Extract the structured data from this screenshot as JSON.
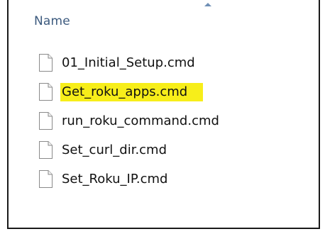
{
  "explorer": {
    "column_header": "Name",
    "sort_direction": "ascending",
    "highlight_color": "#f7ee1a",
    "files": [
      {
        "name": "01_Initial_Setup.cmd",
        "highlighted": false
      },
      {
        "name": "Get_roku_apps.cmd",
        "highlighted": true
      },
      {
        "name": "run_roku_command.cmd",
        "highlighted": false
      },
      {
        "name": "Set_curl_dir.cmd",
        "highlighted": false
      },
      {
        "name": "Set_Roku_IP.cmd",
        "highlighted": false
      }
    ]
  }
}
